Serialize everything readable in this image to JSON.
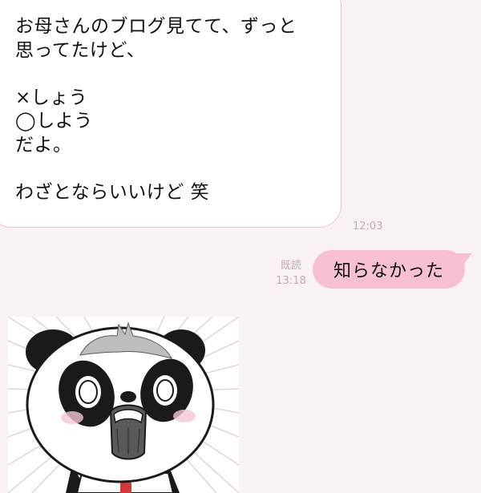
{
  "chat": {
    "incoming": {
      "text": "お母さんのブログ見てて、ずっと\n思ってたけど、\n\n×しょう\n◯しよう\nだよ。\n\nわざとならいいけど 笑",
      "time": "12:03"
    },
    "outgoing": {
      "text": "知らなかった",
      "read_label": "既読",
      "time": "13:18"
    },
    "sticker": {
      "icon": "shocked-panda-sticker"
    }
  },
  "colors": {
    "background": "#f8f2f4",
    "incoming_bubble": "#ffffff",
    "incoming_border": "#f0c3d0",
    "outgoing_bubble": "#f7c0d1",
    "timestamp": "#c9a7b1"
  }
}
